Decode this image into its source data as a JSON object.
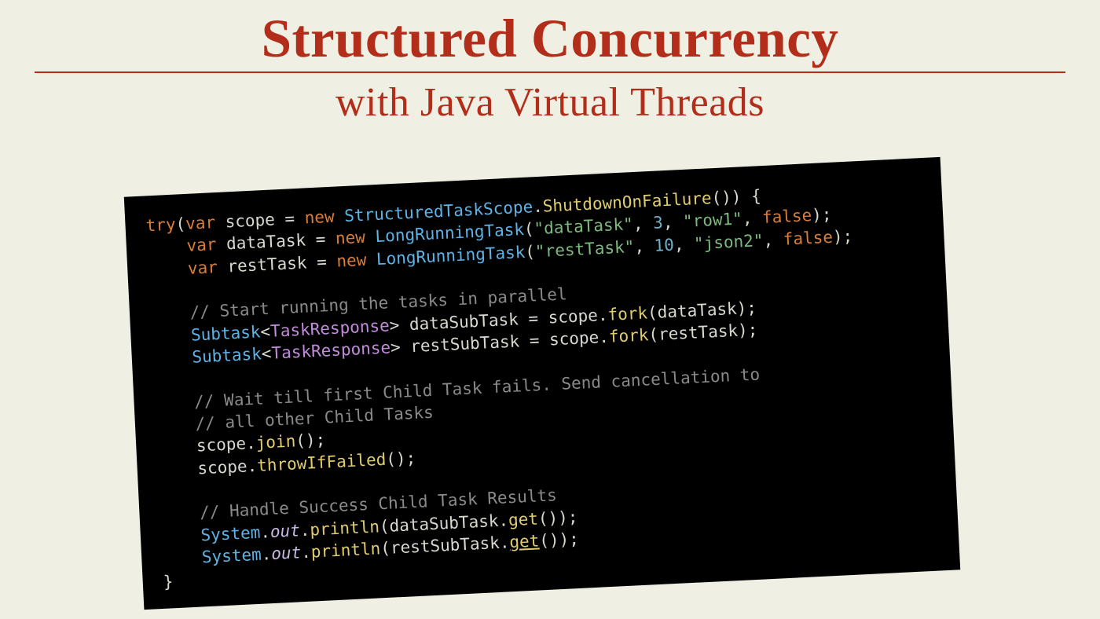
{
  "title": "Structured Concurrency",
  "subtitle": "with Java Virtual Threads",
  "code": {
    "l1": {
      "try": "try",
      "var": "var",
      "scope": "scope",
      "eq": " = ",
      "new": "new",
      "cls": "StructuredTaskScope",
      "dot": ".",
      "m": "ShutdownOnFailure",
      "tail": "()) {"
    },
    "l2": {
      "var": "var",
      "name": "dataTask",
      "eq": " = ",
      "new": "new",
      "cls": "LongRunningTask",
      "open": "(",
      "s1": "\"dataTask\"",
      "c1": ", ",
      "n1": "3",
      "c2": ", ",
      "s2": "\"row1\"",
      "c3": ", ",
      "b": "false",
      "close": ");"
    },
    "l3": {
      "var": "var",
      "name": "restTask",
      "eq": " = ",
      "new": "new",
      "cls": "LongRunningTask",
      "open": "(",
      "s1": "\"restTask\"",
      "c1": ", ",
      "n1": "10",
      "c2": ", ",
      "s2": "\"json2\"",
      "c3": ", ",
      "b": "false",
      "close": ");"
    },
    "c1": "// Start running the tasks in parallel",
    "l4": {
      "cls": "Subtask",
      "lt": "<",
      "gen": "TaskResponse",
      "gt": "> ",
      "v": "dataSubTask",
      "eq": " = scope.",
      "m": "fork",
      "arg": "(dataTask);"
    },
    "l5": {
      "cls": "Subtask",
      "lt": "<",
      "gen": "TaskResponse",
      "gt": "> ",
      "v": "restSubTask",
      "eq": " = scope.",
      "m": "fork",
      "arg": "(restTask);"
    },
    "c2a": "// Wait till first Child Task fails. Send cancellation to",
    "c2b": "// all other Child Tasks",
    "l6": {
      "pre": "scope.",
      "m": "join",
      "tail": "();"
    },
    "l7": {
      "pre": "scope.",
      "m": "throwIfFailed",
      "tail": "();"
    },
    "c3": "// Handle Success Child Task Results",
    "l8": {
      "sys": "System",
      "d1": ".",
      "out": "out",
      "d2": ".",
      "pl": "println",
      "op": "(dataSubTask.",
      "get": "get",
      "tail": "());"
    },
    "l9": {
      "sys": "System",
      "d1": ".",
      "out": "out",
      "d2": ".",
      "pl": "println",
      "op": "(restSubTask.",
      "get": "get",
      "tail": "());"
    },
    "end": "}"
  }
}
